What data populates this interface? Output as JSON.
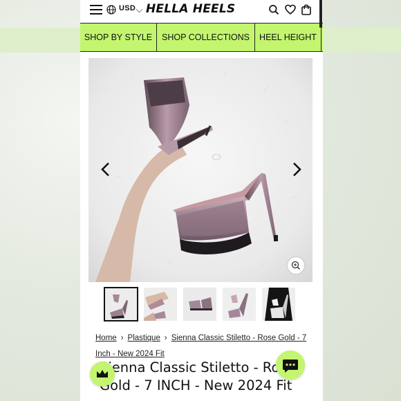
{
  "header": {
    "currency": "USD",
    "logo_text": "HELLA HEELS",
    "icons": [
      "menu-icon",
      "globe-icon",
      "chevron-down-icon",
      "search-icon",
      "heart-icon",
      "bag-icon"
    ]
  },
  "nav": {
    "items": [
      {
        "label": "SHOP BY STYLE"
      },
      {
        "label": "SHOP COLLECTIONS"
      },
      {
        "label": "HEEL HEIGHT"
      }
    ]
  },
  "gallery": {
    "thumbnail_count": 5,
    "selected_index": 0
  },
  "breadcrumb": {
    "items": [
      "Home",
      "Plastique",
      "Sienna Classic Stiletto - Rose Gold - 7 Inch - New 2024 Fit"
    ]
  },
  "product": {
    "title_line1": "Sienna Classic Stiletto - Rose",
    "title_line2": "Gold - 7 INCH - New 2024 Fit"
  },
  "colors": {
    "accent": "#c3f56f",
    "text": "#111111",
    "shoe": "#b497a4"
  }
}
